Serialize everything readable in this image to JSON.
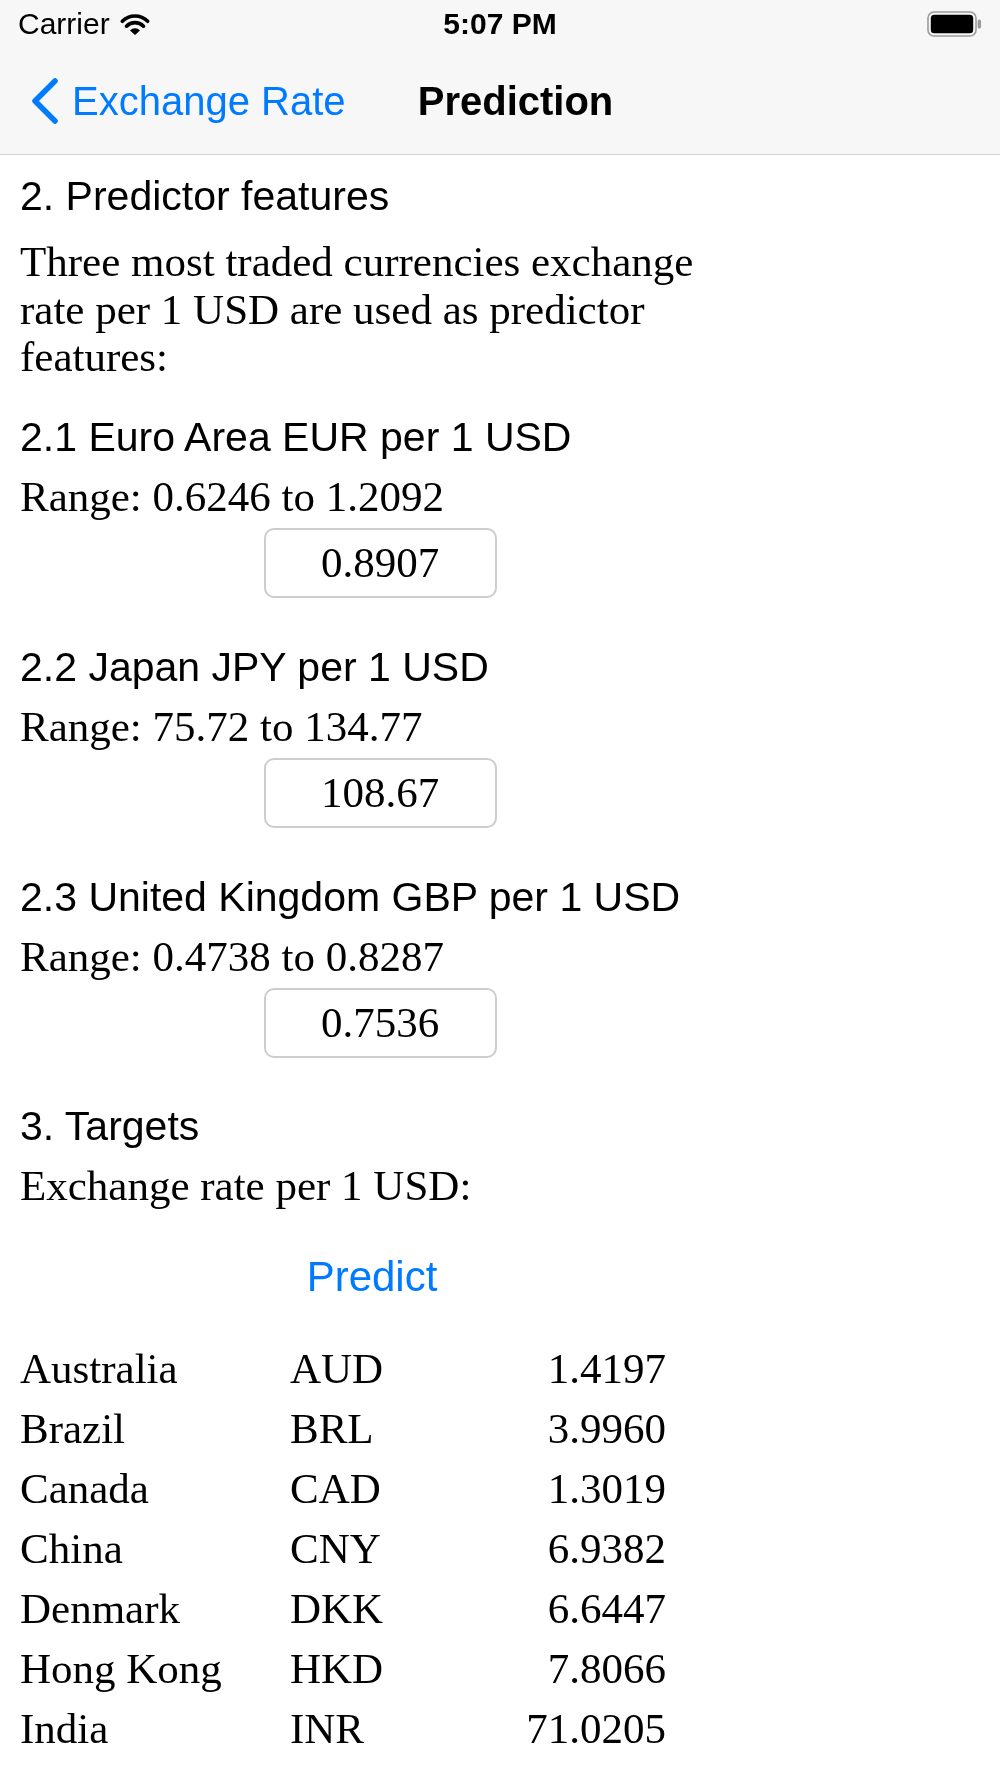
{
  "status_bar": {
    "carrier": "Carrier",
    "time": "5:07 PM"
  },
  "nav_bar": {
    "back_label": "Exchange Rate",
    "title": "Prediction"
  },
  "predictors": {
    "heading": "2. Predictor features",
    "description": "Three most traded currencies exchange rate per 1 USD are used as predictor features:",
    "features": [
      {
        "heading": "2.1 Euro Area EUR per 1 USD",
        "range": "Range: 0.6246 to 1.2092",
        "value": "0.8907"
      },
      {
        "heading": "2.2 Japan JPY per 1 USD",
        "range": "Range: 75.72 to 134.77",
        "value": "108.67"
      },
      {
        "heading": "2.3 United Kingdom GBP per 1 USD",
        "range": "Range: 0.4738 to 0.8287",
        "value": "0.7536"
      }
    ]
  },
  "targets": {
    "heading": "3. Targets",
    "description": "Exchange rate per 1 USD:",
    "button": "Predict",
    "rows": [
      {
        "country": "Australia",
        "code": "AUD",
        "rate": "1.4197"
      },
      {
        "country": "Brazil",
        "code": "BRL",
        "rate": "3.9960"
      },
      {
        "country": "Canada",
        "code": "CAD",
        "rate": "1.3019"
      },
      {
        "country": "China",
        "code": "CNY",
        "rate": "6.9382"
      },
      {
        "country": "Denmark",
        "code": "DKK",
        "rate": "6.6447"
      },
      {
        "country": "Hong Kong",
        "code": "HKD",
        "rate": "7.8066"
      },
      {
        "country": "India",
        "code": "INR",
        "rate": "71.0205"
      }
    ]
  }
}
